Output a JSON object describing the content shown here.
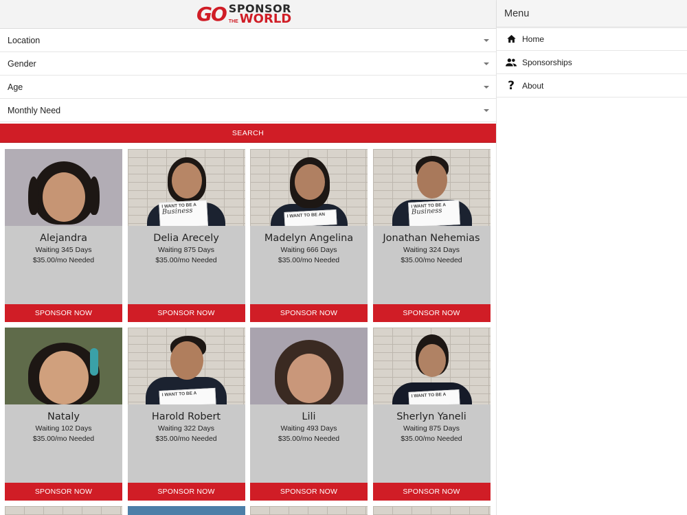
{
  "brand": {
    "go": "GO",
    "sponsor": "SPONSOR",
    "the": "THE",
    "world": "WORLD",
    "accent_color": "#d01d26"
  },
  "filters": [
    {
      "label": "Location"
    },
    {
      "label": "Gender"
    },
    {
      "label": "Age"
    },
    {
      "label": "Monthly Need"
    }
  ],
  "search_label": "SEARCH",
  "children": [
    {
      "name": "Alejandra",
      "waiting": "Waiting 345 Days",
      "need": "$35.00/mo Needed",
      "button": "SPONSOR NOW"
    },
    {
      "name": "Delia Arecely",
      "waiting": "Waiting 875 Days",
      "need": "$35.00/mo Needed",
      "button": "SPONSOR NOW",
      "sign_top": "I WANT TO BE A",
      "sign_word": "Business"
    },
    {
      "name": "Madelyn Angelina",
      "waiting": "Waiting 666 Days",
      "need": "$35.00/mo Needed",
      "button": "SPONSOR NOW",
      "sign_top": "I WANT TO BE AN"
    },
    {
      "name": "Jonathan Nehemias",
      "waiting": "Waiting 324 Days",
      "need": "$35.00/mo Needed",
      "button": "SPONSOR NOW",
      "sign_top": "I WANT TO BE A",
      "sign_word": "Business"
    },
    {
      "name": "Nataly",
      "waiting": "Waiting 102 Days",
      "need": "$35.00/mo Needed",
      "button": "SPONSOR NOW"
    },
    {
      "name": "Harold Robert",
      "waiting": "Waiting 322 Days",
      "need": "$35.00/mo Needed",
      "button": "SPONSOR NOW",
      "sign_top": "I WANT TO BE A"
    },
    {
      "name": "Lili",
      "waiting": "Waiting 493 Days",
      "need": "$35.00/mo Needed",
      "button": "SPONSOR NOW"
    },
    {
      "name": "Sherlyn Yaneli",
      "waiting": "Waiting 875 Days",
      "need": "$35.00/mo Needed",
      "button": "SPONSOR NOW",
      "sign_top": "I WANT TO BE A"
    }
  ],
  "menu": {
    "title": "Menu",
    "items": [
      {
        "label": "Home",
        "icon": "home-icon"
      },
      {
        "label": "Sponsorships",
        "icon": "people-icon"
      },
      {
        "label": "About",
        "icon": "question-icon"
      }
    ]
  }
}
